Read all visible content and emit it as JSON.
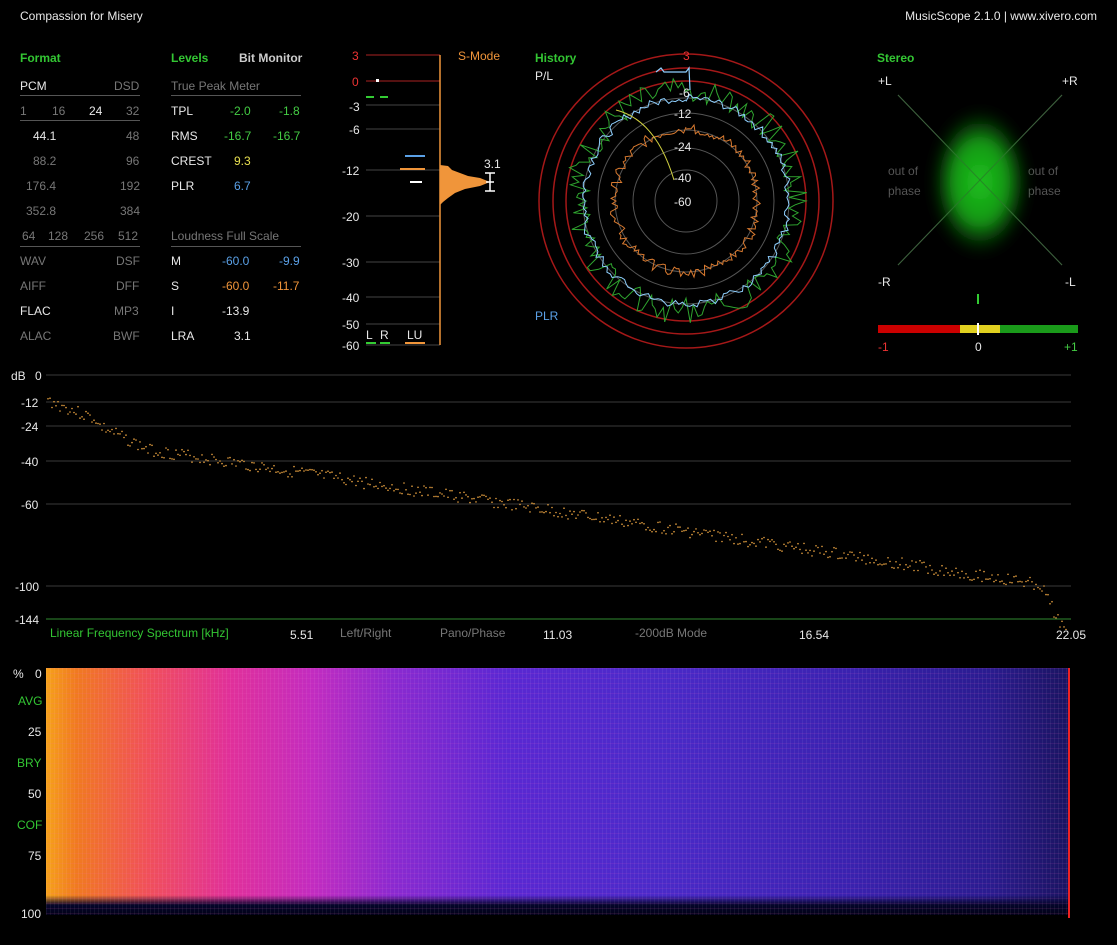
{
  "header": {
    "track": "Compassion for Misery",
    "app": "MusicScope 2.1.0 | www.xivero.com"
  },
  "format": {
    "title": "Format",
    "rows": [
      [
        "PCM",
        "DSD"
      ],
      [
        "1",
        "16",
        "24",
        "32"
      ],
      [
        "44.1",
        "48"
      ],
      [
        "88.2",
        "96"
      ],
      [
        "176.4",
        "192"
      ],
      [
        "352.8",
        "384"
      ],
      [
        "64",
        "128",
        "256",
        "512"
      ],
      [
        "WAV",
        "DSF"
      ],
      [
        "AIFF",
        "DFF"
      ],
      [
        "FLAC",
        "MP3"
      ],
      [
        "ALAC",
        "BWF"
      ]
    ]
  },
  "levels": {
    "title": "Levels",
    "bit_monitor": "Bit Monitor",
    "true_peak_title": "True Peak Meter",
    "tpl": {
      "label": "TPL",
      "l": "-2.0",
      "r": "-1.8"
    },
    "rms": {
      "label": "RMS",
      "l": "-16.7",
      "r": "-16.7"
    },
    "crest": {
      "label": "CREST",
      "v": "9.3"
    },
    "plr": {
      "label": "PLR",
      "v": "6.7"
    },
    "loudness_title": "Loudness Full Scale",
    "m": {
      "label": "M",
      "a": "-60.0",
      "b": "-9.9"
    },
    "s": {
      "label": "S",
      "a": "-60.0",
      "b": "-11.7"
    },
    "i": {
      "label": "I",
      "v": "-13.9"
    },
    "lra": {
      "label": "LRA",
      "v": "3.1"
    }
  },
  "meter": {
    "scale": [
      "3",
      "0",
      "-3",
      "-6",
      "-12",
      "-20",
      "-30",
      "-40",
      "-50",
      "-60"
    ],
    "smode": "S-Mode",
    "lra_value": "3.1",
    "labels": [
      "L",
      "R",
      "LU"
    ]
  },
  "history": {
    "title": "History",
    "pl": "P/L",
    "plr": "PLR",
    "rings": [
      "3",
      "-6",
      "-12",
      "-24",
      "-40",
      "-60"
    ]
  },
  "stereo": {
    "title": "Stereo",
    "plus_l": "+L",
    "plus_r": "+R",
    "minus_r": "-R",
    "minus_l": "-L",
    "out_of_phase_left": [
      "out of",
      "phase"
    ],
    "out_of_phase_right": [
      "out of",
      "phase"
    ],
    "corr": [
      "-1",
      "0",
      "+1"
    ]
  },
  "spectrum": {
    "db_label": "dB",
    "y_ticks": [
      "0",
      "-12",
      "-24",
      "-40",
      "-60",
      "-100",
      "-144"
    ],
    "title": "Linear Frequency Spectrum [kHz]",
    "x_ticks": [
      "5.51",
      "11.03",
      "16.54",
      "22.05"
    ],
    "buttons": [
      "Left/Right",
      "Pano/Phase",
      "-200dB Mode"
    ]
  },
  "spectrogram": {
    "labels": [
      "%",
      "0",
      "AVG",
      "25",
      "BRY",
      "50",
      "COF",
      "75",
      "100"
    ]
  },
  "colors": {
    "accent_green": "#33c633",
    "orange": "#f0953a",
    "red": "#e33",
    "blue": "#5aa0e6"
  }
}
